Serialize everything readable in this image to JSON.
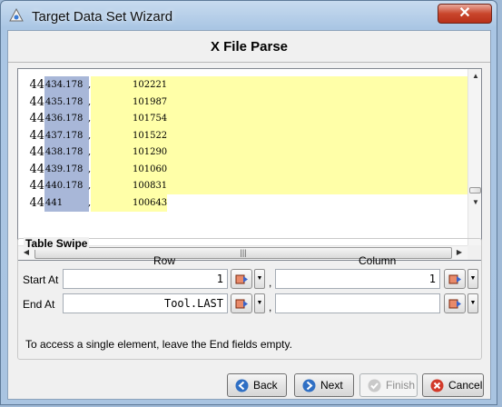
{
  "window": {
    "title": "Target Data Set Wizard",
    "close_glyph": "✕"
  },
  "header": {
    "title": "X File Parse"
  },
  "data_rows": [
    {
      "index": "44",
      "x": "434.178",
      "sep": ",",
      "y": "102221"
    },
    {
      "index": "44",
      "x": "435.178",
      "sep": ",",
      "y": "101987"
    },
    {
      "index": "44",
      "x": "436.178",
      "sep": ",",
      "y": "101754"
    },
    {
      "index": "44",
      "x": "437.178",
      "sep": ",",
      "y": "101522"
    },
    {
      "index": "44",
      "x": "438.178",
      "sep": ",",
      "y": "101290"
    },
    {
      "index": "44",
      "x": "439.178",
      "sep": ",",
      "y": "101060"
    },
    {
      "index": "44",
      "x": "440.178",
      "sep": ",",
      "y": "100831"
    },
    {
      "index": "44",
      "x": "441",
      "sep": ",",
      "y": "100643"
    }
  ],
  "table_swipe": {
    "legend": "Table Swipe",
    "row_header": "Row",
    "column_header": "Column",
    "start_label": "Start At",
    "end_label": "End At",
    "start_row": "1",
    "start_column": "1",
    "end_row": "Tool.LAST",
    "end_column": "",
    "separator": ",",
    "hint": "To access a single element, leave the End fields empty."
  },
  "buttons": {
    "back": "Back",
    "next": "Next",
    "finish": "Finish",
    "cancel": "Cancel"
  },
  "colors": {
    "index_column": "#a8b7d8",
    "value_column": "#ffffa8",
    "back_icon": "#2f6fc4",
    "next_icon": "#2f6fc4",
    "cancel_icon": "#d23a2a"
  }
}
